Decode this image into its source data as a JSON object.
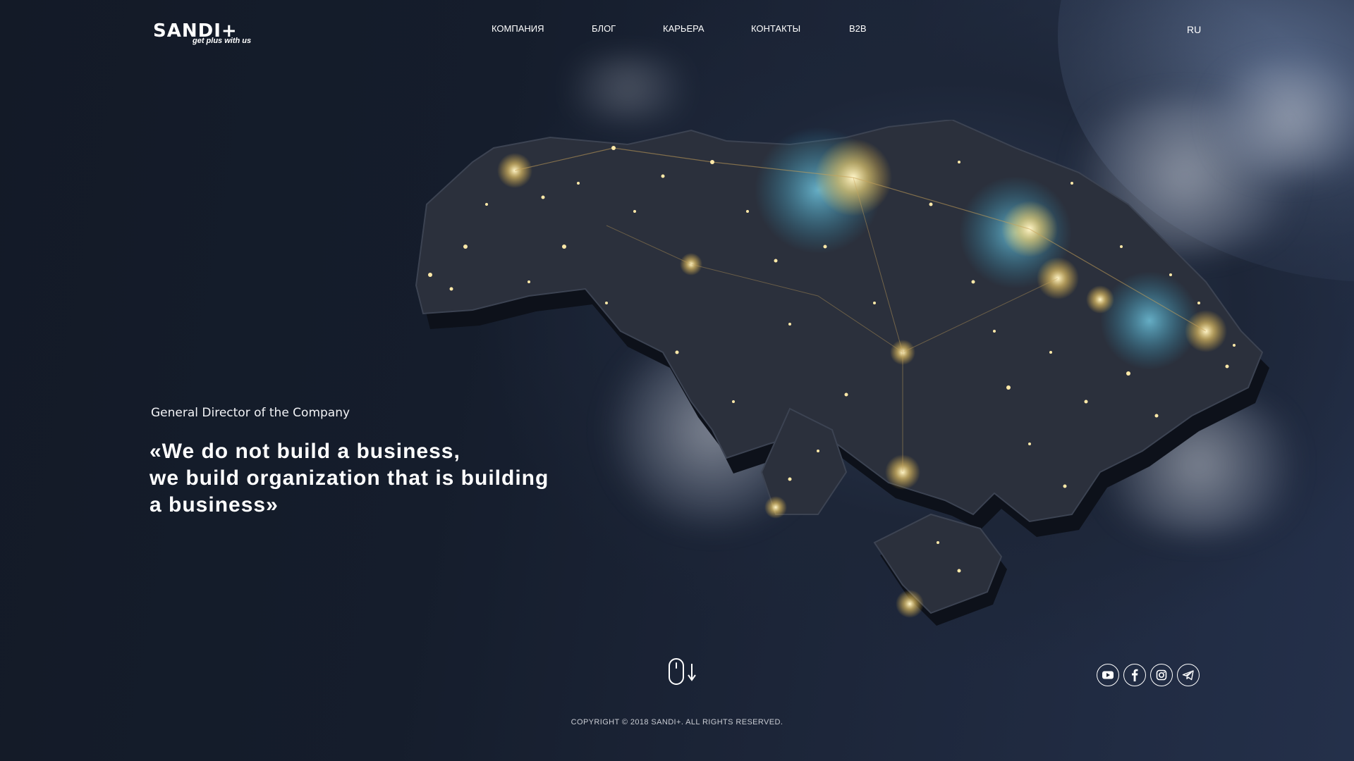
{
  "brand": {
    "name": "SANDI+",
    "tagline": "get plus with us"
  },
  "nav": {
    "items": [
      {
        "label": "КОМПАНИЯ"
      },
      {
        "label": "БЛОГ"
      },
      {
        "label": "КАРЬЕРА"
      },
      {
        "label": "КОНТАКТЫ"
      },
      {
        "label": "B2B"
      }
    ],
    "language": "RU"
  },
  "hero": {
    "author": "General Director of the Company",
    "quote_lines": [
      "«We do not build a business,",
      "we build organization that is building",
      "a business»"
    ]
  },
  "social": {
    "icons": [
      "youtube-icon",
      "facebook-icon",
      "instagram-icon",
      "telegram-icon"
    ]
  },
  "footer": {
    "copyright": "COPYRIGHT © 2018 SANDI+. ALL RIGHTS RESERVED."
  },
  "colors": {
    "background": "#141b28",
    "text": "#ffffff",
    "city_lights": "#ffe9a8",
    "city_glow_blue": "#3fb6d8"
  }
}
